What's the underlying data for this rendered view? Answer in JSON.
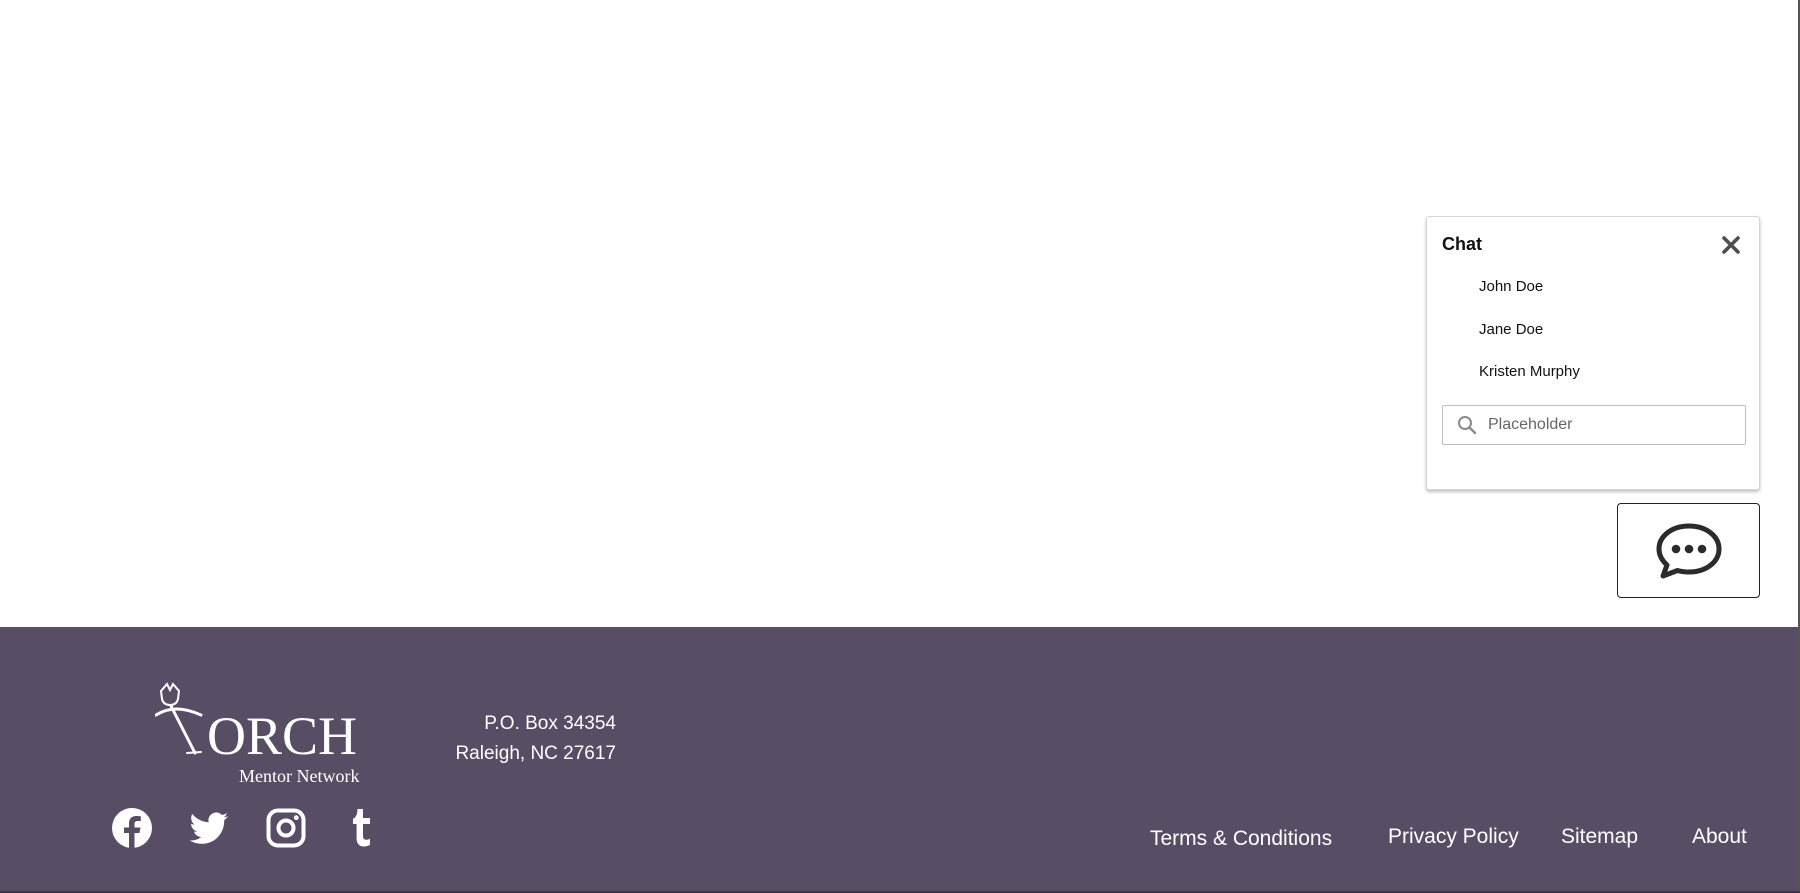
{
  "chat": {
    "title": "Chat",
    "contacts": [
      "John Doe",
      "Jane Doe",
      "Kristen Murphy"
    ],
    "search_placeholder": "Placeholder",
    "search_value": ""
  },
  "footer": {
    "background": "#574e66",
    "logo": {
      "word": "ORCH",
      "subtitle": "Mentor Network"
    },
    "address": {
      "line1": "P.O. Box 34354",
      "line2": "Raleigh, NC 27617"
    },
    "social_icons": [
      "facebook-icon",
      "twitter-icon",
      "instagram-icon",
      "tumblr-icon"
    ],
    "links": {
      "terms": "Terms & Conditions",
      "privacy": "Privacy Policy",
      "sitemap": "Sitemap",
      "about": "About"
    }
  }
}
